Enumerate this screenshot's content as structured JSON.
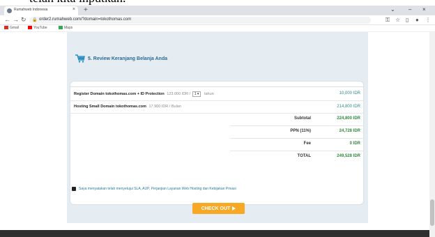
{
  "caption": {
    "text": "telah kita inputkan."
  },
  "browser": {
    "tab_title": "Rumahweb Indonesia",
    "tab_close": "×",
    "new_tab": "+",
    "url": "order2.rumahweb.com/?domain=tokothomas.com",
    "window_controls": [
      "⌄",
      "–",
      "×"
    ],
    "bookmarks": [
      {
        "label": "Gmail",
        "color": "#d93025"
      },
      {
        "label": "YouTube",
        "color": "#ff0000"
      },
      {
        "label": "Maps",
        "color": "#34a853"
      }
    ]
  },
  "section": {
    "title": "5. Review Keranjang Belanja Anda"
  },
  "items": [
    {
      "name": "Register Domain tokothomas.com + ID Protection",
      "meta_before": "123.000 IDR /",
      "select_value": "1",
      "meta_after": "tahun",
      "price": "10,000 IDR"
    },
    {
      "name": "Hosting Small Domain tokothomas.com",
      "meta": "17.900 IDR / Bulan",
      "price": "214,800 IDR"
    }
  ],
  "summary": [
    {
      "label": "Subtotal",
      "value": "224,800 IDR"
    },
    {
      "label": "PPN (11%)",
      "value": "24,728 IDR"
    },
    {
      "label": "Fee",
      "value": "0 IDR"
    },
    {
      "label": "TOTAL",
      "value": "249,528 IDR"
    }
  ],
  "agreement": {
    "text": "Saya menyatakan telah menyetujui SLA, AUP, Perjanjian Layanan Web Hosting dan Kebijakan Privasi",
    "checked": true
  },
  "checkout": {
    "label": "CHECK OUT"
  },
  "colors": {
    "accent": "#2c6b93",
    "price": "#2e8b8b",
    "summary_value": "#2e8b3a",
    "button": "#f7a825",
    "panel_bg": "#e5ecf2"
  }
}
